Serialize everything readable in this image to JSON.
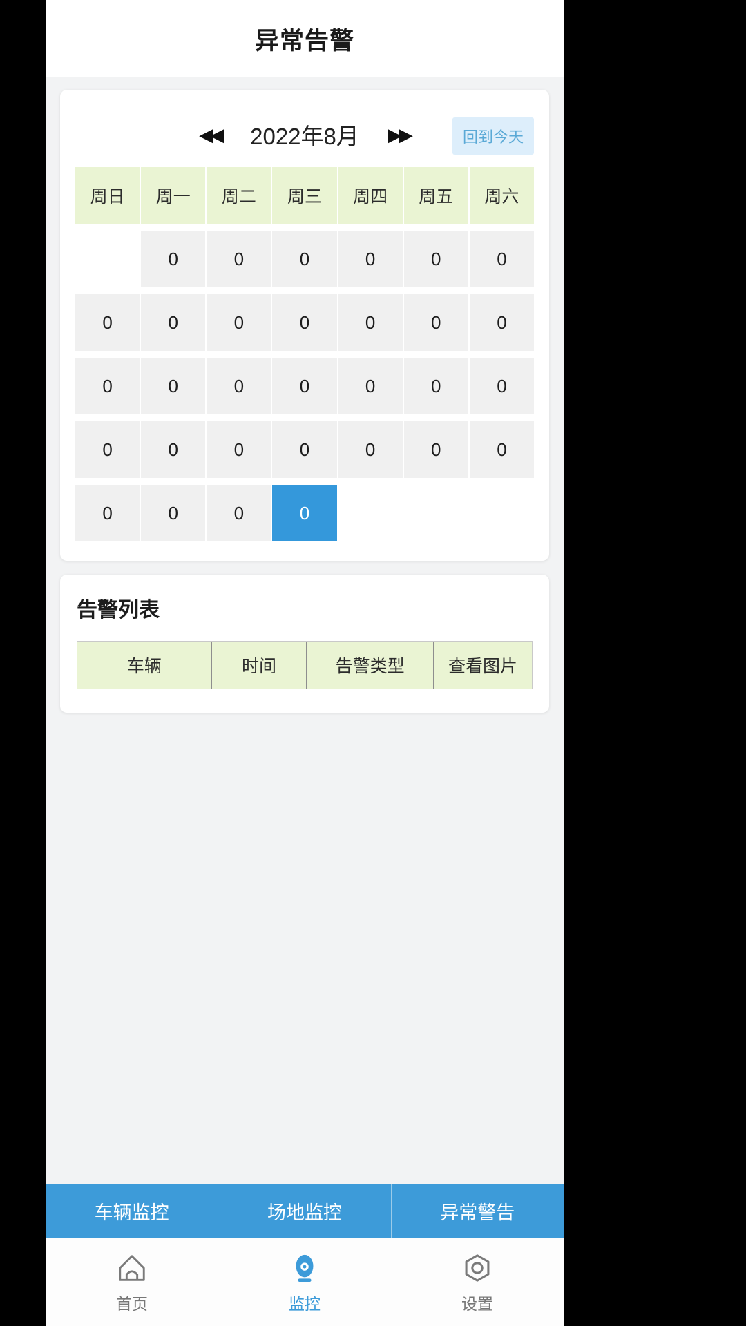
{
  "header": {
    "title": "异常告警"
  },
  "calendar": {
    "prev_label": "◀◀",
    "next_label": "▶▶",
    "month_label": "2022年8月",
    "today_button": "回到今天",
    "weekdays": [
      "周日",
      "周一",
      "周二",
      "周三",
      "周四",
      "周五",
      "周六"
    ],
    "weeks": [
      [
        {
          "value": "",
          "empty": true,
          "selected": false
        },
        {
          "value": "0",
          "empty": false,
          "selected": false
        },
        {
          "value": "0",
          "empty": false,
          "selected": false
        },
        {
          "value": "0",
          "empty": false,
          "selected": false
        },
        {
          "value": "0",
          "empty": false,
          "selected": false
        },
        {
          "value": "0",
          "empty": false,
          "selected": false
        },
        {
          "value": "0",
          "empty": false,
          "selected": false
        }
      ],
      [
        {
          "value": "0",
          "empty": false,
          "selected": false
        },
        {
          "value": "0",
          "empty": false,
          "selected": false
        },
        {
          "value": "0",
          "empty": false,
          "selected": false
        },
        {
          "value": "0",
          "empty": false,
          "selected": false
        },
        {
          "value": "0",
          "empty": false,
          "selected": false
        },
        {
          "value": "0",
          "empty": false,
          "selected": false
        },
        {
          "value": "0",
          "empty": false,
          "selected": false
        }
      ],
      [
        {
          "value": "0",
          "empty": false,
          "selected": false
        },
        {
          "value": "0",
          "empty": false,
          "selected": false
        },
        {
          "value": "0",
          "empty": false,
          "selected": false
        },
        {
          "value": "0",
          "empty": false,
          "selected": false
        },
        {
          "value": "0",
          "empty": false,
          "selected": false
        },
        {
          "value": "0",
          "empty": false,
          "selected": false
        },
        {
          "value": "0",
          "empty": false,
          "selected": false
        }
      ],
      [
        {
          "value": "0",
          "empty": false,
          "selected": false
        },
        {
          "value": "0",
          "empty": false,
          "selected": false
        },
        {
          "value": "0",
          "empty": false,
          "selected": false
        },
        {
          "value": "0",
          "empty": false,
          "selected": false
        },
        {
          "value": "0",
          "empty": false,
          "selected": false
        },
        {
          "value": "0",
          "empty": false,
          "selected": false
        },
        {
          "value": "0",
          "empty": false,
          "selected": false
        }
      ],
      [
        {
          "value": "0",
          "empty": false,
          "selected": false
        },
        {
          "value": "0",
          "empty": false,
          "selected": false
        },
        {
          "value": "0",
          "empty": false,
          "selected": false
        },
        {
          "value": "0",
          "empty": false,
          "selected": true
        },
        {
          "value": "",
          "empty": true,
          "selected": false
        },
        {
          "value": "",
          "empty": true,
          "selected": false
        },
        {
          "value": "",
          "empty": true,
          "selected": false
        }
      ]
    ],
    "selected_color": "#3498db",
    "weekday_bg": "#eaf4d3",
    "cell_bg": "#f0f0f0",
    "today_btn_bg": "#ddeefb",
    "today_btn_color": "#5aa9d6"
  },
  "alarm_list": {
    "title": "告警列表",
    "columns": [
      "车辆",
      "时间",
      "告警类型",
      "查看图片"
    ],
    "rows": []
  },
  "segmented_tabs": {
    "active_color": "#3d9bd9",
    "items": [
      {
        "label": "车辆监控"
      },
      {
        "label": "场地监控"
      },
      {
        "label": "异常警告"
      }
    ]
  },
  "bottom_nav": {
    "active_color": "#3d9bd9",
    "inactive_color": "#777777",
    "items": [
      {
        "label": "首页",
        "icon": "home-icon",
        "active": false
      },
      {
        "label": "监控",
        "icon": "camera-icon",
        "active": true
      },
      {
        "label": "设置",
        "icon": "gear-icon",
        "active": false
      }
    ]
  }
}
